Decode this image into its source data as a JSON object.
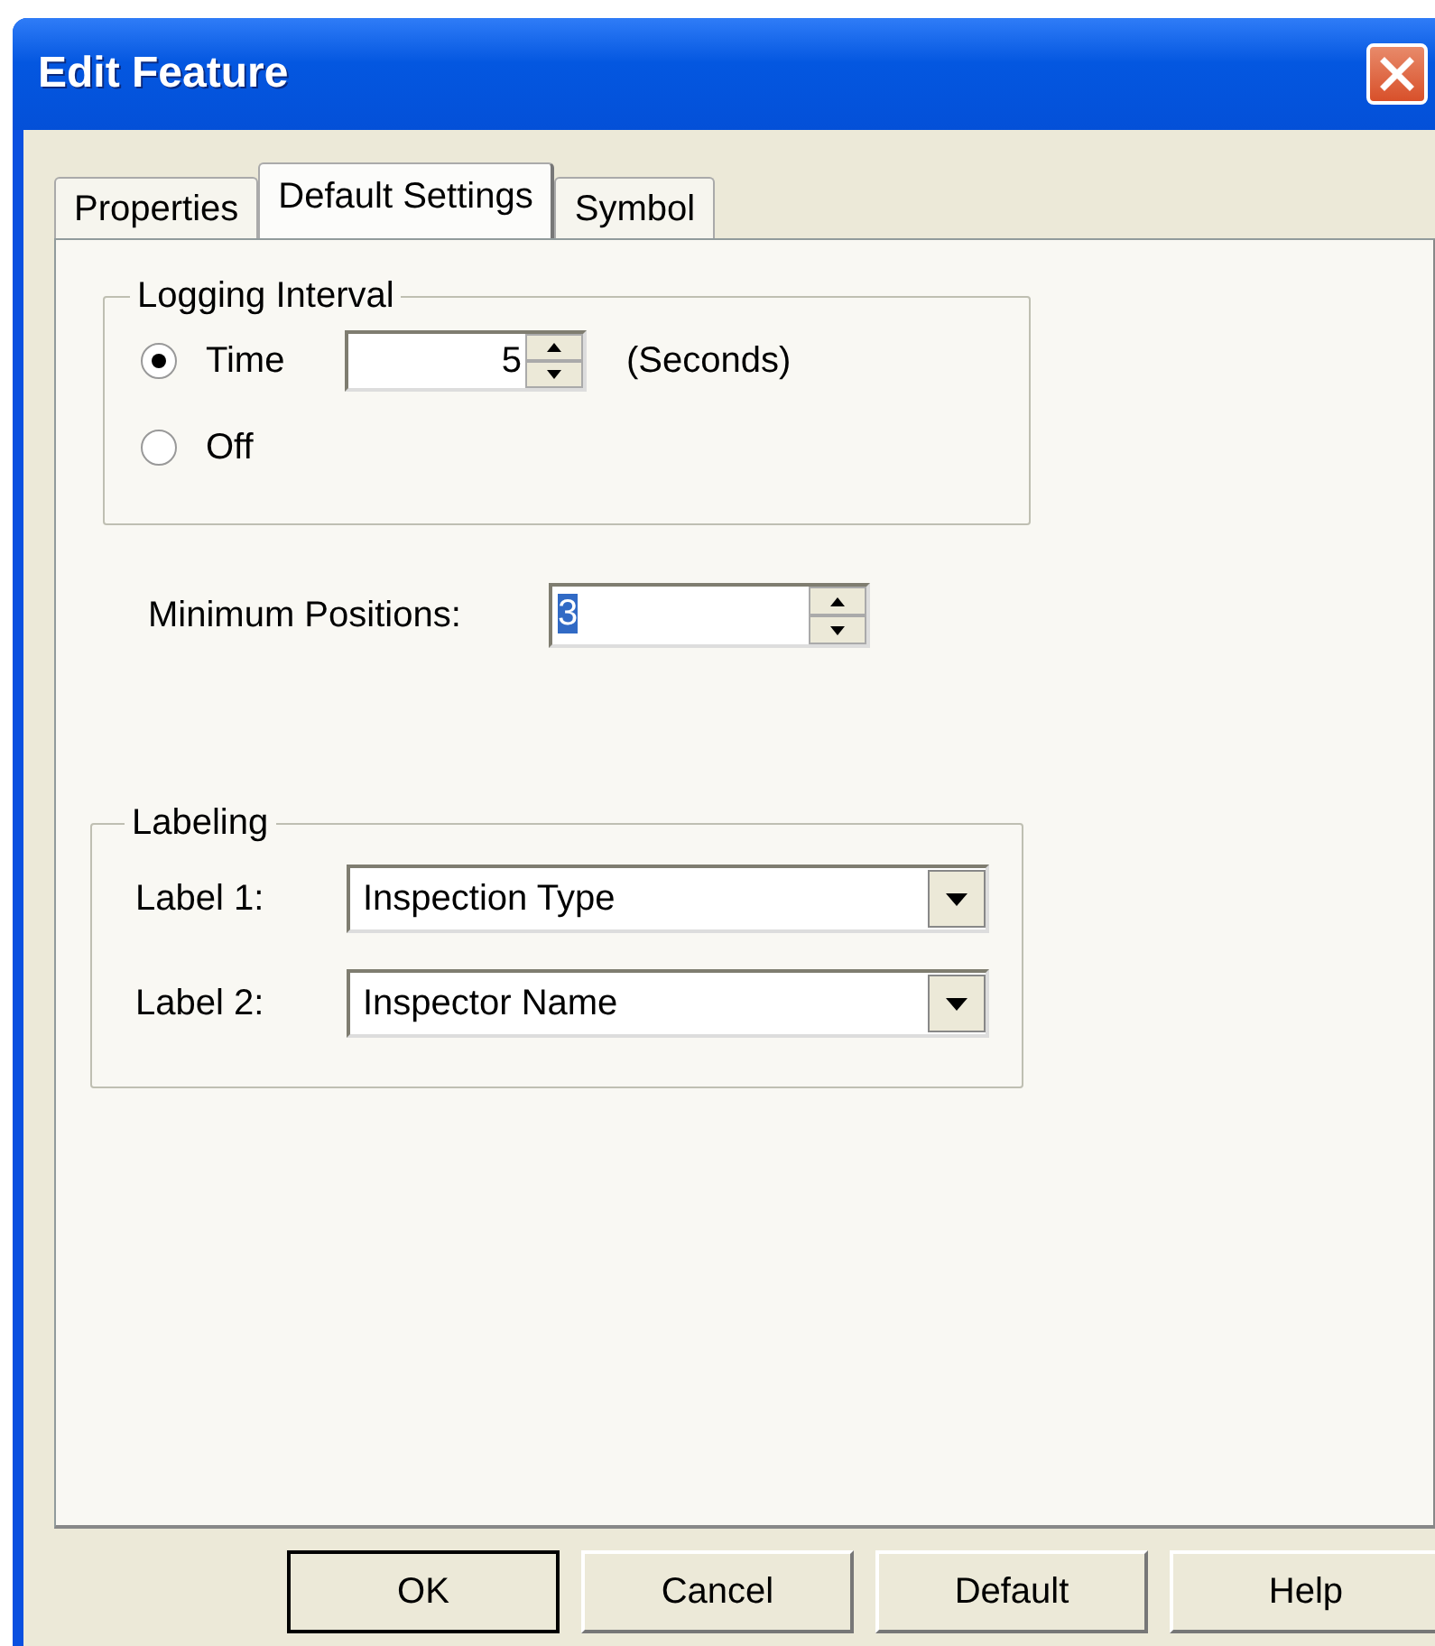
{
  "window": {
    "title": "Edit Feature"
  },
  "tabs": [
    {
      "label": "Properties",
      "selected": false
    },
    {
      "label": "Default Settings",
      "selected": true
    },
    {
      "label": "Symbol",
      "selected": false
    }
  ],
  "logging_interval": {
    "title": "Logging Interval",
    "options": [
      {
        "label": "Time",
        "selected": true
      },
      {
        "label": "Off",
        "selected": false
      }
    ],
    "time_value": "5",
    "unit": "(Seconds)"
  },
  "minimum_positions": {
    "label": "Minimum Positions:",
    "value": "3",
    "value_selected": true
  },
  "labeling": {
    "title": "Labeling",
    "fields": [
      {
        "label": "Label 1:",
        "value": "Inspection Type"
      },
      {
        "label": "Label 2:",
        "value": "Inspector Name"
      }
    ]
  },
  "buttons": [
    {
      "label": "OK",
      "default": true
    },
    {
      "label": "Cancel",
      "default": false
    },
    {
      "label": "Default",
      "default": false
    },
    {
      "label": "Help",
      "default": false
    }
  ]
}
